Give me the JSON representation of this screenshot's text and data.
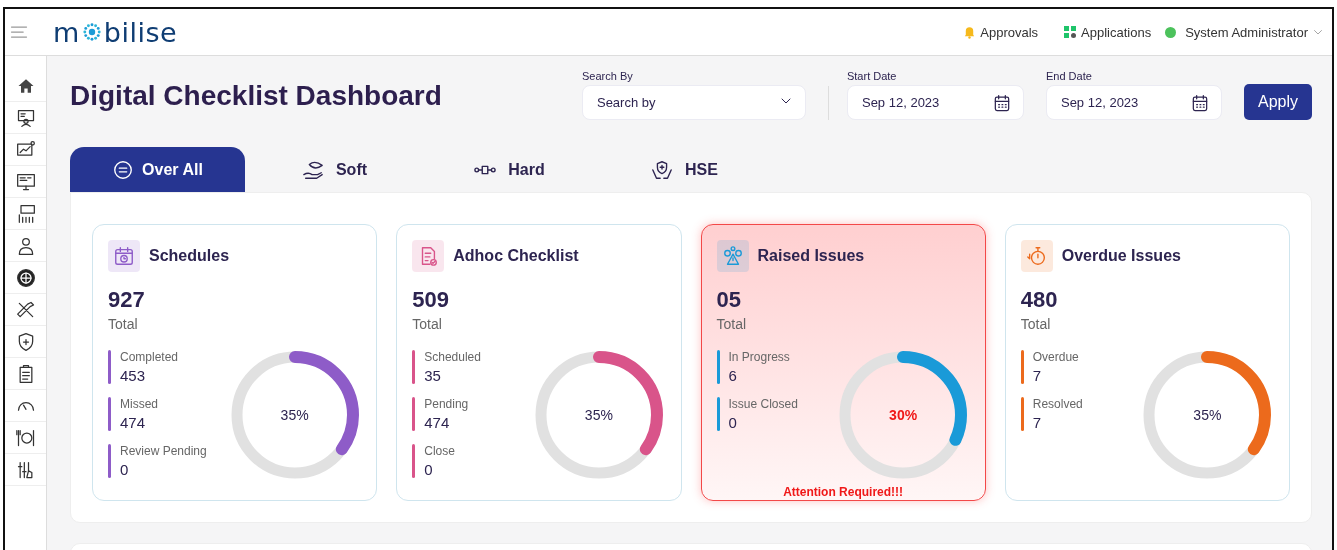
{
  "header": {
    "logo": [
      "m",
      "bilise"
    ],
    "links": [
      {
        "label": "Approvals",
        "kind": "bell"
      },
      {
        "label": "Applications",
        "kind": "apps"
      }
    ],
    "user": {
      "name": "System Administrator"
    }
  },
  "page": {
    "title": "Digital Checklist Dashboard"
  },
  "filters": {
    "search": {
      "label": "Search By",
      "placeholder": "Search by"
    },
    "start_date": {
      "label": "Start Date",
      "value": "Sep 12, 2023"
    },
    "end_date": {
      "label": "End Date",
      "value": "Sep 12, 2023"
    },
    "apply": "Apply"
  },
  "tabs": [
    {
      "label": "Over All",
      "selected": true
    },
    {
      "label": "Soft",
      "selected": false
    },
    {
      "label": "Hard",
      "selected": false
    },
    {
      "label": "HSE",
      "selected": false
    }
  ],
  "cards": [
    {
      "title": "Schedules",
      "total": "927",
      "total_label": "Total",
      "color": "#8e5cc8",
      "alert": false,
      "stats": [
        {
          "label": "Completed",
          "value": "453"
        },
        {
          "label": "Missed",
          "value": "474"
        },
        {
          "label": "Review Pending",
          "value": "0"
        }
      ],
      "gauge": {
        "level": 0.35,
        "reading": "35%"
      }
    },
    {
      "title": "Adhoc Checklist",
      "total": "509",
      "total_label": "Total",
      "color": "#d9548a",
      "alert": false,
      "stats": [
        {
          "label": "Scheduled",
          "value": "35"
        },
        {
          "label": "Pending",
          "value": "474"
        },
        {
          "label": "Close",
          "value": "0"
        }
      ],
      "gauge": {
        "level": 0.35,
        "reading": "35%"
      }
    },
    {
      "title": "Raised Issues",
      "total": "05",
      "total_label": "Total",
      "color": "#1a9ad8",
      "alert": true,
      "note": "Attention Required!!!",
      "stats": [
        {
          "label": "In Progress",
          "value": "6"
        },
        {
          "label": "Issue Closed",
          "value": "0"
        }
      ],
      "gauge": {
        "level": 0.32,
        "reading": "30%"
      }
    },
    {
      "title": "Overdue Issues",
      "total": "480",
      "total_label": "Total",
      "color": "#ec6a1c",
      "alert": false,
      "stats": [
        {
          "label": "Overdue",
          "value": "7"
        },
        {
          "label": "Resolved",
          "value": "7"
        }
      ],
      "gauge": {
        "level": 0.35,
        "reading": "35%"
      }
    }
  ]
}
